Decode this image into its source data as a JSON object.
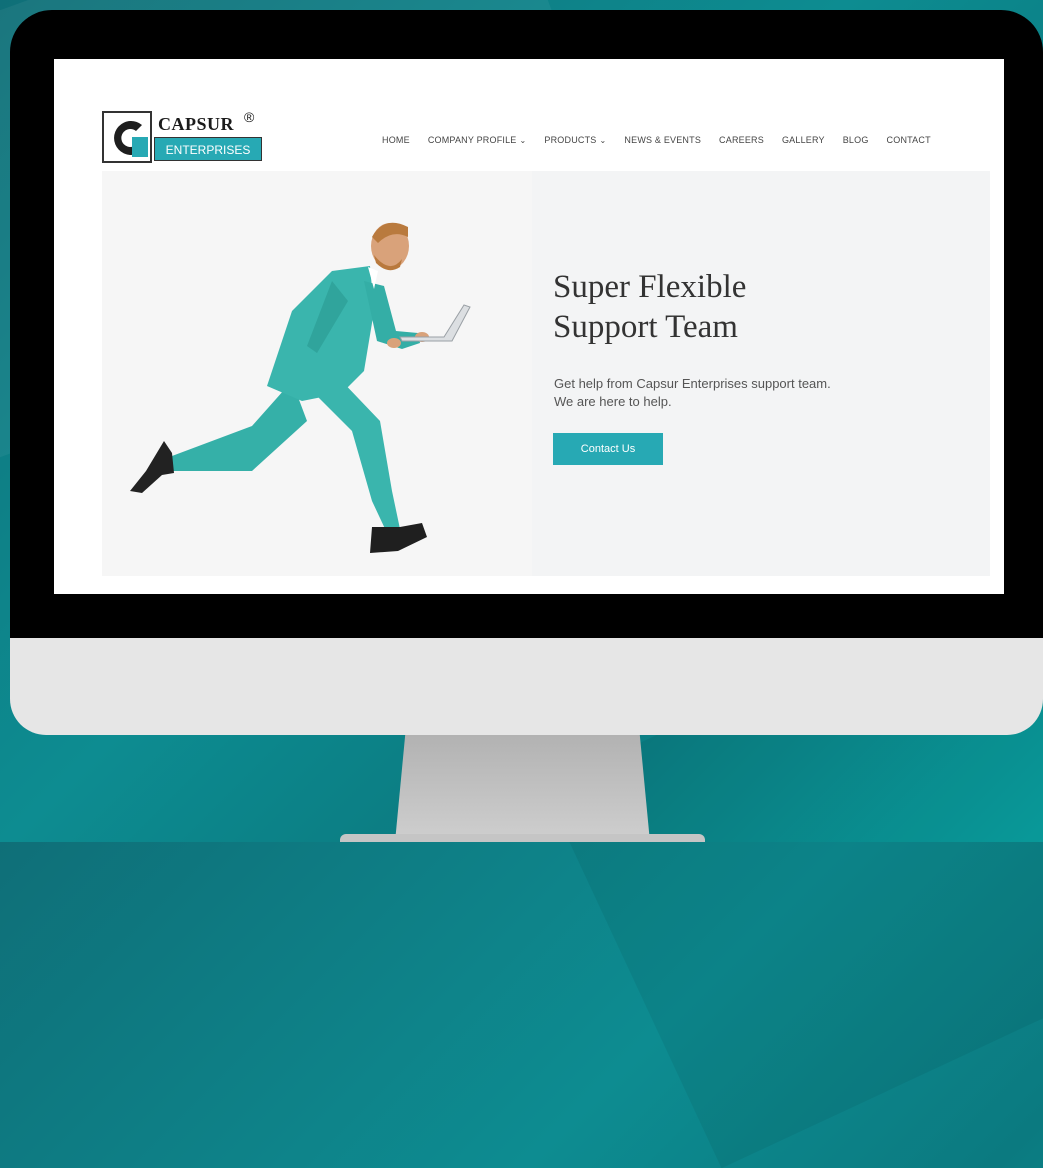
{
  "colors": {
    "accent": "#27a9b4",
    "suit": "#3ab5ad",
    "background": "#0d8c91"
  },
  "logo": {
    "name": "CAPSUR",
    "reg_mark": "®",
    "tagline": "ENTERPRISES"
  },
  "nav": {
    "items": [
      {
        "label": "HOME"
      },
      {
        "label": "COMPANY PROFILE",
        "has_dropdown": true
      },
      {
        "label": "PRODUCTS",
        "has_dropdown": true
      },
      {
        "label": "NEWS & EVENTS"
      },
      {
        "label": "CAREERS"
      },
      {
        "label": "GALLERY"
      },
      {
        "label": "BLOG"
      },
      {
        "label": "CONTACT"
      }
    ],
    "dropdown_icon": "chevron-down-icon"
  },
  "hero": {
    "title_line1": "Super Flexible",
    "title_line2": "Support Team",
    "subtitle_line1": "Get help from Capsur Enterprises support team.",
    "subtitle_line2": "We are here to help.",
    "cta_label": "Contact Us",
    "image": "man-in-teal-suit-running-with-laptop"
  }
}
